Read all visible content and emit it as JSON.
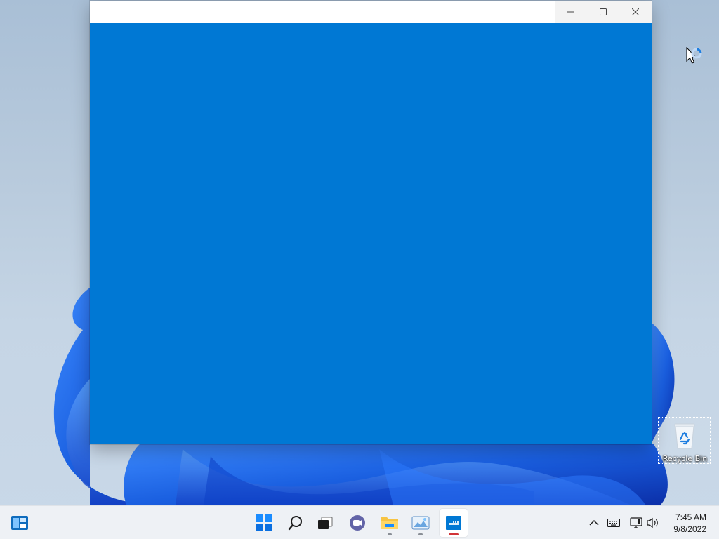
{
  "desktop": {
    "icons": [
      {
        "label": "Recycle Bin",
        "icon": "recycle-bin-icon"
      }
    ]
  },
  "window": {
    "title": "",
    "background_color": "#0078d4",
    "controls": [
      "minimize-icon",
      "maximize-icon",
      "close-icon"
    ]
  },
  "taskbar": {
    "widgets_icon": "widgets-icon",
    "apps": [
      {
        "name": "start-icon",
        "running": false
      },
      {
        "name": "search-icon",
        "running": false
      },
      {
        "name": "task-view-icon",
        "running": false
      },
      {
        "name": "chat-icon",
        "running": false
      },
      {
        "name": "file-explorer-icon",
        "running": true
      },
      {
        "name": "photos-icon",
        "running": true
      },
      {
        "name": "active-app-icon",
        "running": true,
        "focused": true
      }
    ],
    "tray": [
      "show-hidden-icons-chevron",
      "keyboard-icon",
      "network-icon",
      "volume-icon"
    ],
    "clock": {
      "time": "7:45 AM",
      "date": "9/8/2022"
    }
  },
  "colors": {
    "accent": "#0078d4",
    "focused_indicator": "#d13438",
    "wallpaper_blue": "#1a5fe0"
  }
}
